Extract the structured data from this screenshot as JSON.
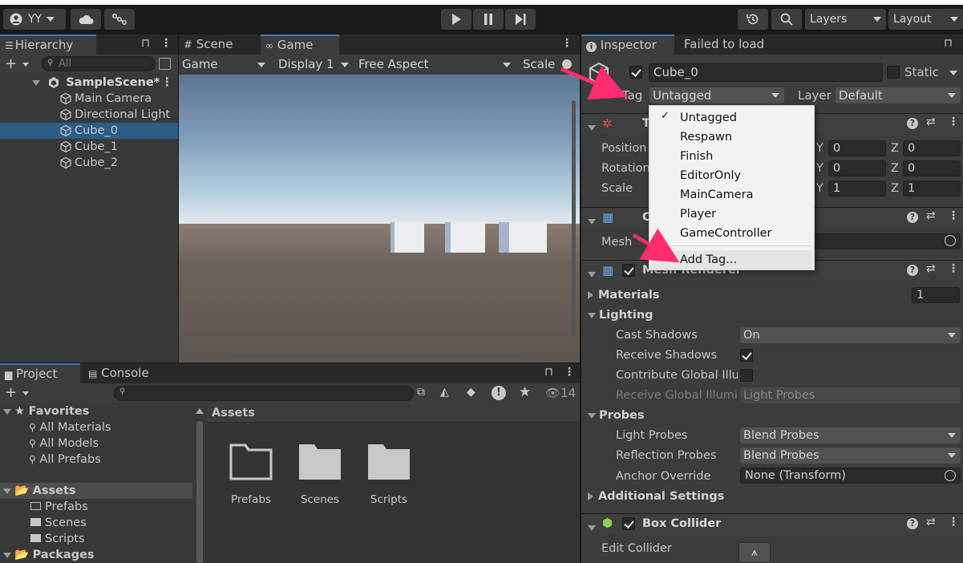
{
  "toolbar": {
    "account": "YY",
    "layers": "Layers",
    "layout": "Layout"
  },
  "hierarchy": {
    "tab": "Hierarchy",
    "search_placeholder": "All",
    "scene": "SampleScene*",
    "items": [
      "Main Camera",
      "Directional Light",
      "Cube_0",
      "Cube_1",
      "Cube_2"
    ],
    "selected": "Cube_0"
  },
  "view": {
    "tab_scene": "Scene",
    "tab_game": "Game",
    "mode": "Game",
    "display": "Display 1",
    "aspect": "Free Aspect",
    "scale": "Scale"
  },
  "project": {
    "tab_project": "Project",
    "tab_console": "Console",
    "hidden_count": "14",
    "favorites": "Favorites",
    "favorite_items": [
      "All Materials",
      "All Models",
      "All Prefabs"
    ],
    "assets": "Assets",
    "asset_folders": [
      "Prefabs",
      "Scenes",
      "Scripts"
    ],
    "packages": "Packages",
    "breadcrumb": "Assets",
    "grid_items": [
      "Prefabs",
      "Scenes",
      "Scripts"
    ]
  },
  "inspector": {
    "tab": "Inspector",
    "tab2": "Failed to load",
    "object_name": "Cube_0",
    "static_label": "Static",
    "tag_label": "Tag",
    "tag_value": "Untagged",
    "layer_label": "Layer",
    "layer_value": "Default",
    "transform": {
      "header": "T",
      "position_label": "Position",
      "rotation_label": "Rotation",
      "scale_label": "Scale",
      "position": {
        "y": "0",
        "z": "0"
      },
      "rotation": {
        "y": "0",
        "z": "0"
      },
      "scale": {
        "y": "1",
        "z": "1"
      }
    },
    "mesh_filter": {
      "header": "C",
      "mesh_label": "Mesh"
    },
    "mesh_renderer": {
      "header": "Mesh Renderer",
      "materials_label": "Materials",
      "materials_count": "1",
      "lighting_label": "Lighting",
      "cast_shadows_label": "Cast Shadows",
      "cast_shadows_value": "On",
      "receive_shadows_label": "Receive Shadows",
      "contribute_gi_label": "Contribute Global Illu",
      "receive_gi_label": "Receive Global Illumi",
      "receive_gi_value": "Light Probes",
      "probes_label": "Probes",
      "light_probes_label": "Light Probes",
      "light_probes_value": "Blend Probes",
      "reflection_probes_label": "Reflection Probes",
      "reflection_probes_value": "Blend Probes",
      "anchor_override_label": "Anchor Override",
      "anchor_override_value": "None (Transform)",
      "additional_settings_label": "Additional Settings"
    },
    "box_collider": {
      "header": "Box Collider",
      "edit_label": "Edit Collider"
    }
  },
  "tag_menu": {
    "items": [
      "Untagged",
      "Respawn",
      "Finish",
      "EditorOnly",
      "MainCamera",
      "Player",
      "GameController"
    ],
    "checked": "Untagged",
    "add_tag": "Add Tag..."
  },
  "colors": {
    "selection": "#2c5d87",
    "annotation_arrow": "#ff2d6f",
    "panel": "#383838",
    "menu": "#f2f2f2"
  }
}
